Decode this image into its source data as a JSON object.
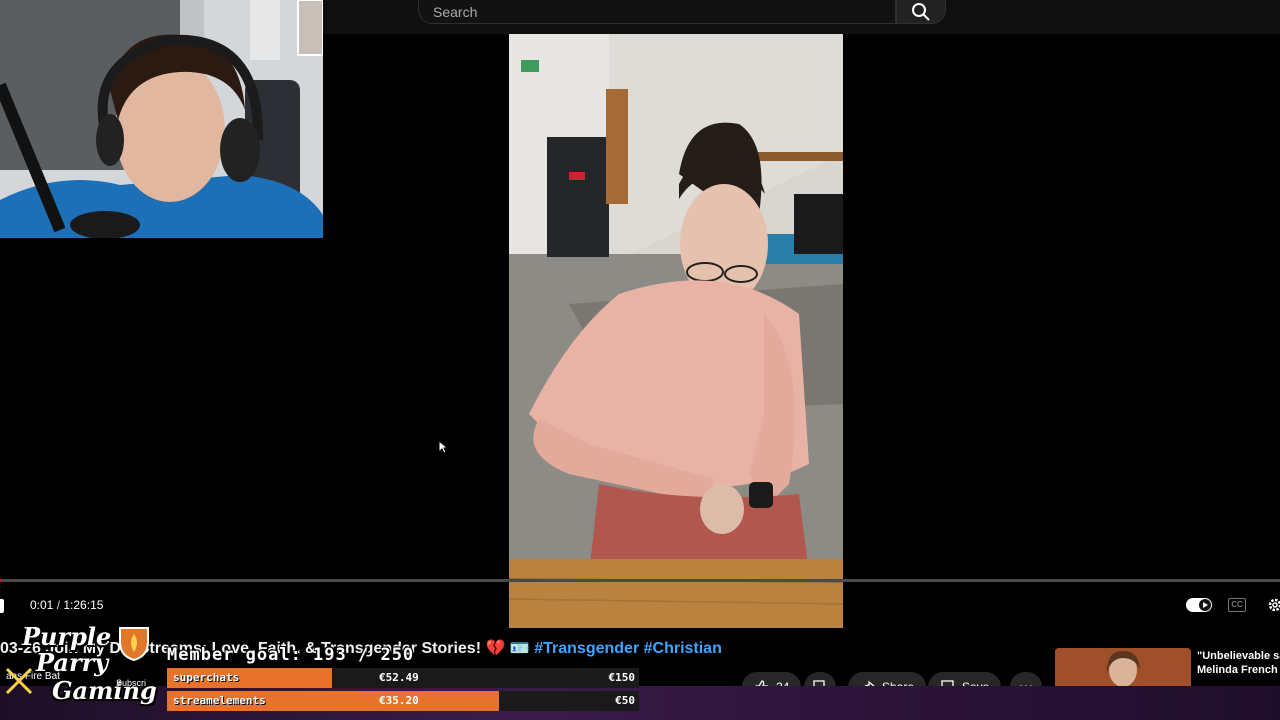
{
  "search": {
    "placeholder": "Search"
  },
  "player": {
    "current_time": "0:01",
    "separator": " / ",
    "duration": "1:26:15",
    "progress_fraction": 0.0002,
    "cc_label": "CC"
  },
  "video": {
    "title_prefix": "03-26 ",
    "title_visible": "Join My D... Streams: Love, Faith, & Transgender Stories!",
    "emoji": "💔 🪪",
    "hashtags": "#Transgender #Christian"
  },
  "actions": {
    "like_count": "24",
    "share_label": "Share",
    "save_label": "Save"
  },
  "recommendation": {
    "title_line1": "\"Unbelievable sa",
    "title_line2": "Melinda French G"
  },
  "overlay": {
    "logo_line1": "Purple",
    "logo_line2": "Parry",
    "logo_line3": "Gaming",
    "logo_sub_left": "ans Fire Bat",
    "logo_sub_right": "Subscri",
    "member_goal": "Member goal: 193 / 250",
    "goals": [
      {
        "label": "superchats",
        "amount": "€52.49",
        "target": "€150",
        "fraction": 0.35
      },
      {
        "label": "streamelements",
        "amount": "€35.20",
        "target": "€50",
        "fraction": 0.704
      }
    ]
  },
  "colors": {
    "accent": "#e8722a",
    "progress": "#ff0000",
    "hashtag": "#3ea6ff",
    "band": "#3a1c4a"
  }
}
